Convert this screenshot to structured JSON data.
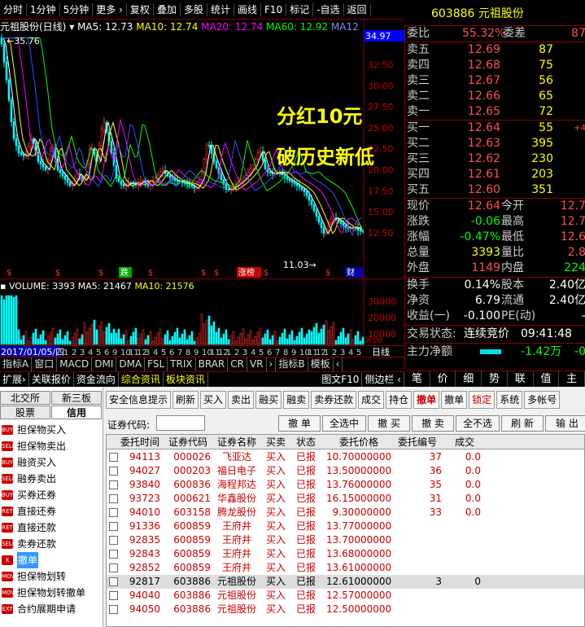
{
  "toolbar": {
    "items": [
      "分时",
      "1分钟",
      "5分钟",
      "更多 ›",
      "复权",
      "叠加",
      "多股",
      "统计",
      "画线",
      "F10",
      "标记",
      "-自选",
      "返回"
    ]
  },
  "stock": {
    "code": "603886",
    "name": "元祖股份",
    "title": "603886 元祖股份"
  },
  "chart": {
    "legend": "元祖股份(日线)",
    "ma5": "MA5: 12.73",
    "ma10": "MA10: 12.74",
    "ma20": "MA20: 12.74",
    "ma60": "MA60: 12.92",
    "ma12": "MA12",
    "high_label": "35.76",
    "low_label": "11.03",
    "price_tag": "34.97",
    "yticks": [
      "32.50",
      "30.00",
      "27.50",
      "25.00",
      "22.50",
      "20.00",
      "17.50",
      "15.00",
      "12.50"
    ],
    "markers": [
      "跌",
      "涨榜",
      "财"
    ],
    "colors": {
      "up": "#ff3030",
      "down": "#00ffff",
      "ma5": "#ffffff",
      "ma10": "#ffff00",
      "ma20": "#ff00ff",
      "ma60": "#00ff00",
      "ma12": "#0000ff"
    }
  },
  "volume": {
    "label": "VOLUME: 3393",
    "ma5": "MA5: 21467",
    "ma10": "MA10: 21576",
    "yticks": [
      "30000",
      "20000",
      "10000",
      "X10"
    ]
  },
  "datebar": {
    "date": "2017/01/05/四",
    "period": "日线",
    "ticks": [
      "1",
      "2",
      "3",
      "4",
      "5",
      "6",
      "9",
      "10",
      "11",
      "12",
      "3",
      "4",
      "5",
      "6",
      "7",
      "8",
      "9",
      "10",
      "11",
      "12",
      "1",
      "2",
      "3",
      "4",
      "5",
      "6",
      "7",
      "8",
      "9",
      "10",
      "11",
      "12",
      "1",
      "2",
      "3",
      "4",
      "5"
    ]
  },
  "overlay": {
    "line1": "分红10元",
    "line2": "破历史新低"
  },
  "quotes": {
    "weibi_label": "委比",
    "weibi": "55.32%",
    "weicha_label": "委差",
    "weicha": "87",
    "sells": [
      {
        "l": "卖五",
        "p": "12.69",
        "v": "87"
      },
      {
        "l": "卖四",
        "p": "12.68",
        "v": "75"
      },
      {
        "l": "卖三",
        "p": "12.67",
        "v": "56"
      },
      {
        "l": "卖二",
        "p": "12.66",
        "v": "65"
      },
      {
        "l": "卖一",
        "p": "12.65",
        "v": "72"
      }
    ],
    "buys": [
      {
        "l": "买一",
        "p": "12.64",
        "v": "55",
        "x": "+4"
      },
      {
        "l": "买二",
        "p": "12.63",
        "v": "395",
        "x": ""
      },
      {
        "l": "买三",
        "p": "12.62",
        "v": "230",
        "x": ""
      },
      {
        "l": "买四",
        "p": "12.61",
        "v": "203",
        "x": ""
      },
      {
        "l": "买五",
        "p": "12.60",
        "v": "351",
        "x": ""
      }
    ],
    "stats": [
      {
        "l": "现价",
        "v": "12.64",
        "l2": "今开",
        "v2": "12.7"
      },
      {
        "l": "涨跌",
        "v": "-0.06",
        "l2": "最高",
        "v2": "12.7"
      },
      {
        "l": "涨幅",
        "v": "-0.47%",
        "l2": "最低",
        "v2": "12.6"
      },
      {
        "l": "总量",
        "v": "3393",
        "l2": "量比",
        "v2": "2.8"
      },
      {
        "l": "外盘",
        "v": "1149",
        "l2": "内盘",
        "v2": "224"
      }
    ],
    "stats2": [
      {
        "l": "换手",
        "v": "0.14%",
        "l2": "股本",
        "v2": "2.40亿"
      },
      {
        "l": "净资",
        "v": "6.79",
        "l2": "流通",
        "v2": "2.40亿"
      },
      {
        "l": "收益(一)",
        "v": "-0.100",
        "l2": "PE(动)",
        "v2": "-"
      }
    ],
    "status_label": "交易状态:",
    "status": "连续竞价",
    "time": "09:41:48",
    "netflow_label": "主力净额",
    "netflow": "-1.42万",
    "netflow2": "-0"
  },
  "tabs1": [
    "指标A",
    "窗口",
    "MACD",
    "DMI",
    "DMA",
    "FSL",
    "TRIX",
    "BRAR",
    "CR",
    "VR",
    "›",
    "指标B",
    "模板",
    "‹"
  ],
  "tabs2": [
    "扩展›",
    "关联报价",
    "资金流向",
    "综合资讯",
    "板块资讯",
    "图文F10",
    "侧边栏 ‹"
  ],
  "rtabs": [
    "笔",
    "价",
    "细",
    "势",
    "联",
    "值",
    "主"
  ],
  "trade": {
    "tabs_top": [
      "北交所",
      "新三板"
    ],
    "tabs_bottom": [
      "股票",
      "信用"
    ],
    "nav": [
      "担保物买入",
      "担保物卖出",
      "融资买入",
      "融券卖出",
      "买券还券",
      "直接还券",
      "直接还款",
      "卖券还款",
      "撤单",
      "担保物划转",
      "担保物划转撤单",
      "合约展期申请"
    ],
    "nav_icons": [
      "BUY",
      "SELL",
      "BUY",
      "SELL",
      "BUY",
      "RET",
      "RET",
      "SELL",
      "X",
      "MOV",
      "MOV",
      "EXT"
    ],
    "toolbar": [
      "安全信息提示",
      "刷新",
      "买入",
      "卖出",
      "融买",
      "融卖",
      "卖券还款",
      "成交",
      "持仓",
      "撤单",
      "撤单",
      "锁定",
      "系统",
      "多帐号"
    ],
    "code_label": "证券代码:",
    "code_buttons": [
      "撤 单",
      "全选中",
      "撤 买",
      "撤 卖",
      "全不选",
      "刷 新",
      "输 出"
    ],
    "headers": [
      "委托时间",
      "证券代码",
      "证券名称",
      "买卖",
      "状态",
      "委托价格",
      "委托编号",
      "成交"
    ],
    "rows": [
      {
        "t": "94113",
        "c": "000026",
        "n": "飞亚达",
        "bs": "买入",
        "st": "已报",
        "p": "10.70000000",
        "id": "37",
        "d": "0.0"
      },
      {
        "t": "94027",
        "c": "000203",
        "n": "福日电子",
        "bs": "买入",
        "st": "已报",
        "p": "13.50000000",
        "id": "36",
        "d": "0.0"
      },
      {
        "t": "93840",
        "c": "600836",
        "n": "海程邦达",
        "bs": "买入",
        "st": "已报",
        "p": "13.76000000",
        "id": "35",
        "d": "0.0"
      },
      {
        "t": "93723",
        "c": "000621",
        "n": "华鑫股份",
        "bs": "买入",
        "st": "已报",
        "p": "16.15000000",
        "id": "31",
        "d": "0.0"
      },
      {
        "t": "94010",
        "c": "603158",
        "n": "腾龙股份",
        "bs": "买入",
        "st": "已报",
        "p": "9.30000000",
        "id": "33",
        "d": "0.0"
      },
      {
        "t": "91336",
        "c": "600859",
        "n": "王府井",
        "bs": "买入",
        "st": "已报",
        "p": "13.77000000",
        "id": "",
        "d": ""
      },
      {
        "t": "92835",
        "c": "600859",
        "n": "王府井",
        "bs": "买入",
        "st": "已报",
        "p": "13.70000000",
        "id": "",
        "d": ""
      },
      {
        "t": "92843",
        "c": "600859",
        "n": "王府井",
        "bs": "买入",
        "st": "已报",
        "p": "13.68000000",
        "id": "",
        "d": ""
      },
      {
        "t": "92852",
        "c": "600859",
        "n": "王府井",
        "bs": "买入",
        "st": "已报",
        "p": "13.61000000",
        "id": "",
        "d": ""
      },
      {
        "t": "92817",
        "c": "603886",
        "n": "元祖股份",
        "bs": "买入",
        "st": "已报",
        "p": "12.61000000",
        "id": "3",
        "d": "0"
      },
      {
        "t": "94040",
        "c": "603886",
        "n": "元祖股份",
        "bs": "买入",
        "st": "已报",
        "p": "12.57000000",
        "id": "",
        "d": ""
      },
      {
        "t": "94050",
        "c": "603886",
        "n": "元祖股份",
        "bs": "买入",
        "st": "已报",
        "p": "12.50000000",
        "id": "",
        "d": ""
      }
    ]
  }
}
